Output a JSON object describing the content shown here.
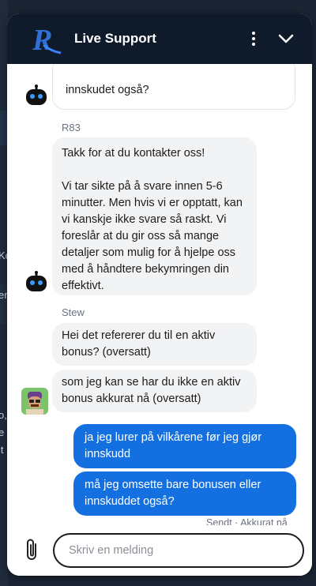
{
  "header": {
    "title": "Live Support",
    "logo_letter": "R",
    "menu_icon": "more-vertical-icon",
    "collapse_icon": "chevron-down-icon"
  },
  "messages": [
    {
      "from": "agent",
      "text": "innskudet også?"
    },
    {
      "sender": "R83"
    },
    {
      "from": "agent",
      "text": "Takk for at du kontakter oss!\n\nVi tar sikte på å svare innen 5-6\nminutter. Men hvis vi er opptatt, kan\nvi kanskje ikke svare så raskt. Vi\nforeslår at du gir oss så mange\ndetaljer som mulig for å hjelpe oss\nmed å håndtere bekymringen din\neffektivt."
    },
    {
      "sender": "Stew"
    },
    {
      "from": "agent",
      "text": "Hei det refererer du til en aktiv\nbonus? (oversatt)"
    },
    {
      "from": "agent",
      "text": "som jeg kan se har du ikke en aktiv\nbonus akkurat nå (oversatt)"
    },
    {
      "from": "user",
      "text": "ja jeg lurer på vilkårene før jeg gjør\ninnskudd"
    },
    {
      "from": "user",
      "text": "må jeg omsette bare bonusen eller\ninnskuddet også?"
    }
  ],
  "status": "Sendt · Akkurat nå",
  "composer": {
    "placeholder": "Skriv en melding",
    "value": ""
  },
  "colors": {
    "header_bg": "#0f1b2b",
    "user_bubble": "#1470e0",
    "agent_bubble": "#f2f3f5"
  },
  "background_page": {
    "glyphs": [
      "Ko",
      "er",
      "o,",
      "e",
      "it"
    ]
  }
}
